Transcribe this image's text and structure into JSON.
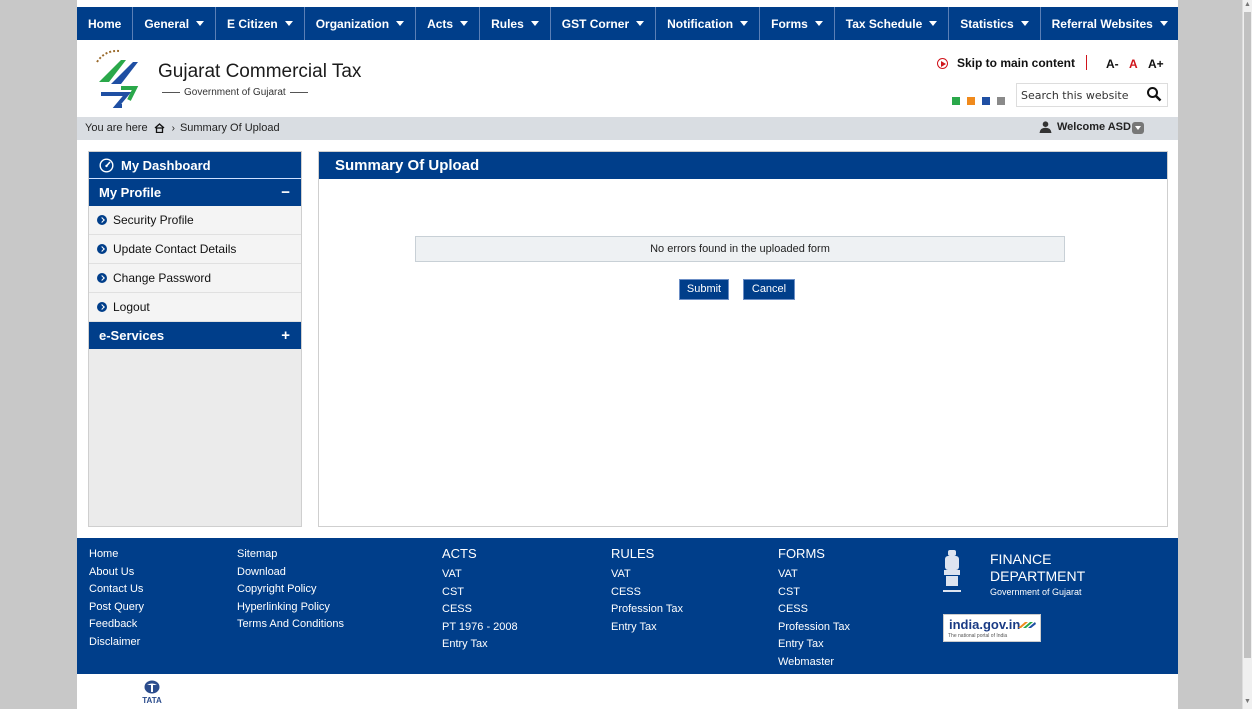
{
  "nav": {
    "items": [
      {
        "label": "Home",
        "dropdown": false
      },
      {
        "label": "General",
        "dropdown": true
      },
      {
        "label": "E Citizen",
        "dropdown": true
      },
      {
        "label": "Organization",
        "dropdown": true
      },
      {
        "label": "Acts",
        "dropdown": true
      },
      {
        "label": "Rules",
        "dropdown": true
      },
      {
        "label": "GST Corner",
        "dropdown": true
      },
      {
        "label": "Notification",
        "dropdown": true
      },
      {
        "label": "Forms",
        "dropdown": true
      },
      {
        "label": "Tax Schedule",
        "dropdown": true
      },
      {
        "label": "Statistics",
        "dropdown": true
      },
      {
        "label": "Referral Websites",
        "dropdown": true
      }
    ]
  },
  "header": {
    "title": "Gujarat Commercial Tax",
    "subtitle": "Government of Gujarat",
    "skip_link": "Skip to main content",
    "font_small": "A-",
    "font_normal": "A",
    "font_large": "A+",
    "search_placeholder": "Search this website",
    "theme_colors": [
      "#2aa84a",
      "#f08a1c",
      "#1f4fa3",
      "#8a8a8a"
    ]
  },
  "breadcrumb": {
    "prefix": "You are here",
    "current": "Summary Of Upload",
    "welcome": "Welcome ASD"
  },
  "sidebar": {
    "dashboard": "My Dashboard",
    "profile": {
      "title": "My Profile",
      "toggle": "−",
      "items": [
        "Security Profile",
        "Update Contact Details",
        "Change Password",
        "Logout"
      ]
    },
    "eservices": {
      "title": "e-Services",
      "toggle": "+"
    }
  },
  "main": {
    "title": "Summary Of Upload",
    "message": "No errors found in the uploaded form",
    "submit_label": "Submit",
    "cancel_label": "Cancel"
  },
  "footer": {
    "links_col1": [
      "Home",
      "About Us",
      "Contact Us",
      "Post Query",
      "Feedback",
      "Disclaimer"
    ],
    "links_col2": [
      "Sitemap",
      "Download",
      "Copyright Policy",
      "Hyperlinking Policy",
      "Terms And Conditions"
    ],
    "acts": {
      "title": "ACTS",
      "items": [
        "VAT",
        "CST",
        "CESS",
        "PT 1976 - 2008",
        "Entry Tax"
      ]
    },
    "rules": {
      "title": "RULES",
      "items": [
        "VAT",
        "CESS",
        "Profession Tax",
        "Entry Tax"
      ]
    },
    "forms": {
      "title": "FORMS",
      "items": [
        "VAT",
        "CST",
        "CESS",
        "Profession Tax",
        "Entry Tax",
        "Webmaster"
      ]
    },
    "finance_title_1": "FINANCE",
    "finance_title_2": "DEPARTMENT",
    "finance_sub": "Government of Gujarat",
    "india_gov_main": "india.gov.in",
    "india_gov_sub": "The national portal of India"
  },
  "tata_label": "TATA",
  "colors": {
    "primary": "#003e8a",
    "accent_red": "#d0141b",
    "page_bg": "#c8c8c8"
  }
}
